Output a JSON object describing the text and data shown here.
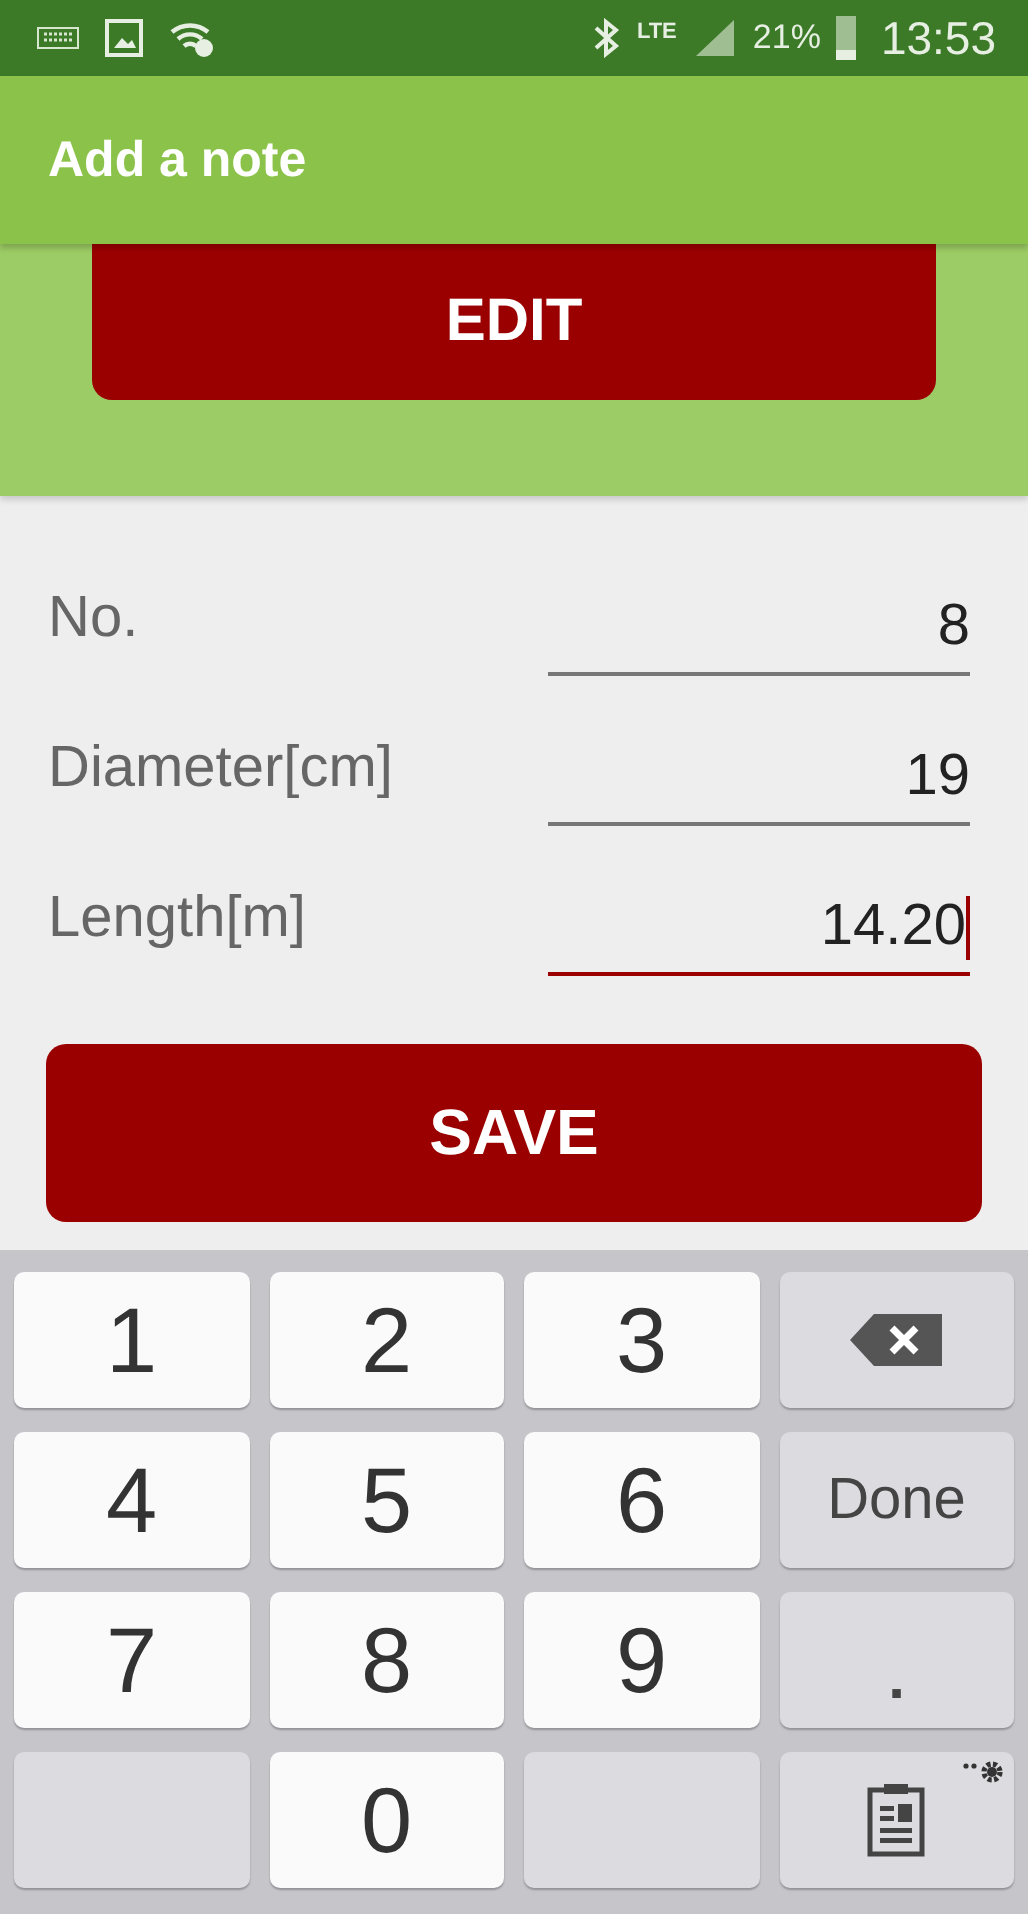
{
  "status_bar": {
    "network": "LTE",
    "battery": "21%",
    "time": "13:53"
  },
  "app_bar": {
    "title": "Add a note"
  },
  "edit_button": {
    "label": "EDIT"
  },
  "fields": [
    {
      "label": "No.",
      "value": "8",
      "focused": false
    },
    {
      "label": "Diameter[cm]",
      "value": "19",
      "focused": false
    },
    {
      "label": "Length[m]",
      "value": "14.20",
      "focused": true
    }
  ],
  "save_button": {
    "label": "SAVE"
  },
  "keyboard": {
    "keys": [
      {
        "kind": "digit",
        "label": "1"
      },
      {
        "kind": "digit",
        "label": "2"
      },
      {
        "kind": "digit",
        "label": "3"
      },
      {
        "kind": "backspace"
      },
      {
        "kind": "digit",
        "label": "4"
      },
      {
        "kind": "digit",
        "label": "5"
      },
      {
        "kind": "digit",
        "label": "6"
      },
      {
        "kind": "action",
        "label": "Done"
      },
      {
        "kind": "digit",
        "label": "7"
      },
      {
        "kind": "digit",
        "label": "8"
      },
      {
        "kind": "digit",
        "label": "9"
      },
      {
        "kind": "symbol",
        "label": "."
      },
      {
        "kind": "blank"
      },
      {
        "kind": "digit",
        "label": "0"
      },
      {
        "kind": "blank"
      },
      {
        "kind": "clipboard"
      }
    ]
  }
}
